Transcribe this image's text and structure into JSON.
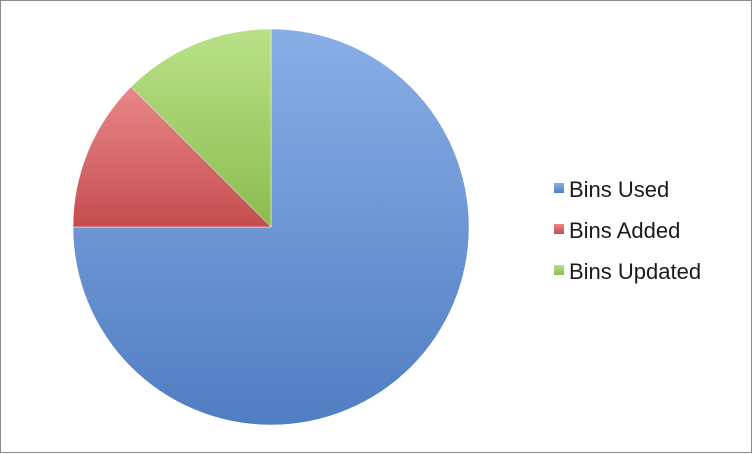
{
  "chart_data": {
    "type": "pie",
    "categories": [
      "Bins Used",
      "Bins Added",
      "Bins Updated"
    ],
    "values": [
      75,
      12.5,
      12.5
    ],
    "colors": [
      "#5b8fdd",
      "#e0585a",
      "#9fd65a"
    ],
    "legend": "right",
    "start_angle_deg": 0,
    "direction": "clockwise"
  }
}
